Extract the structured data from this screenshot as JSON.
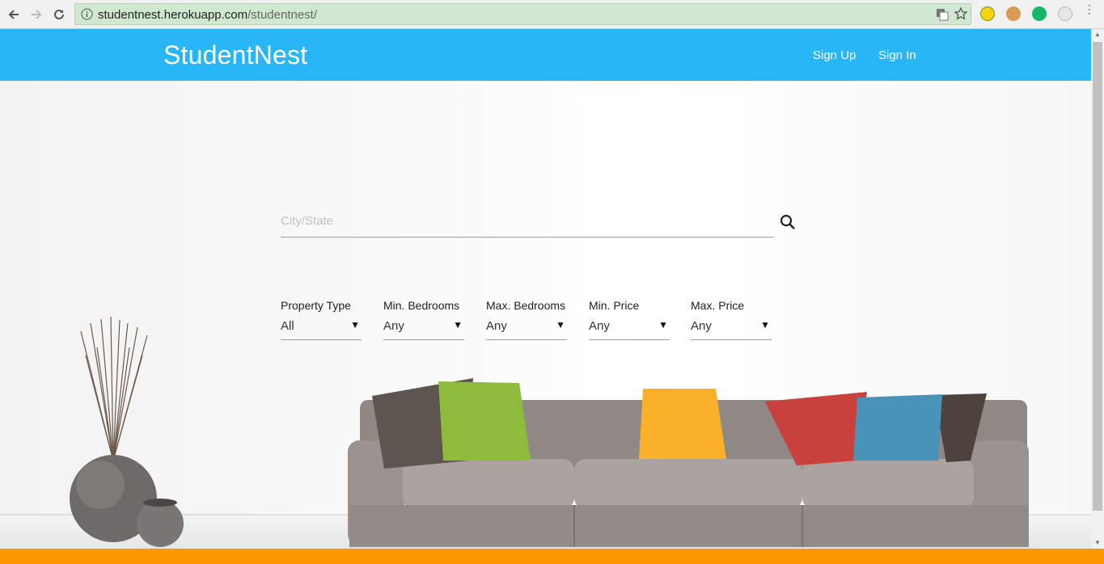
{
  "browser": {
    "url_host": "studentnest.herokuapp.com",
    "url_path": "/studentnest/"
  },
  "header": {
    "brand": "StudentNest",
    "signup_label": "Sign Up",
    "signin_label": "Sign In",
    "color": "#29b6f6"
  },
  "search": {
    "placeholder": "City/State",
    "value": ""
  },
  "filters": [
    {
      "label": "Property Type",
      "value": "All"
    },
    {
      "label": "Min. Bedrooms",
      "value": "Any"
    },
    {
      "label": "Max. Bedrooms",
      "value": "Any"
    },
    {
      "label": "Min. Price",
      "value": "Any"
    },
    {
      "label": "Max. Price",
      "value": "Any"
    }
  ],
  "icons": {
    "back": "back-arrow-icon",
    "forward": "forward-arrow-icon",
    "reload": "reload-icon",
    "info": "info-icon",
    "search": "search-icon"
  },
  "accent_footer": "#ff9800"
}
